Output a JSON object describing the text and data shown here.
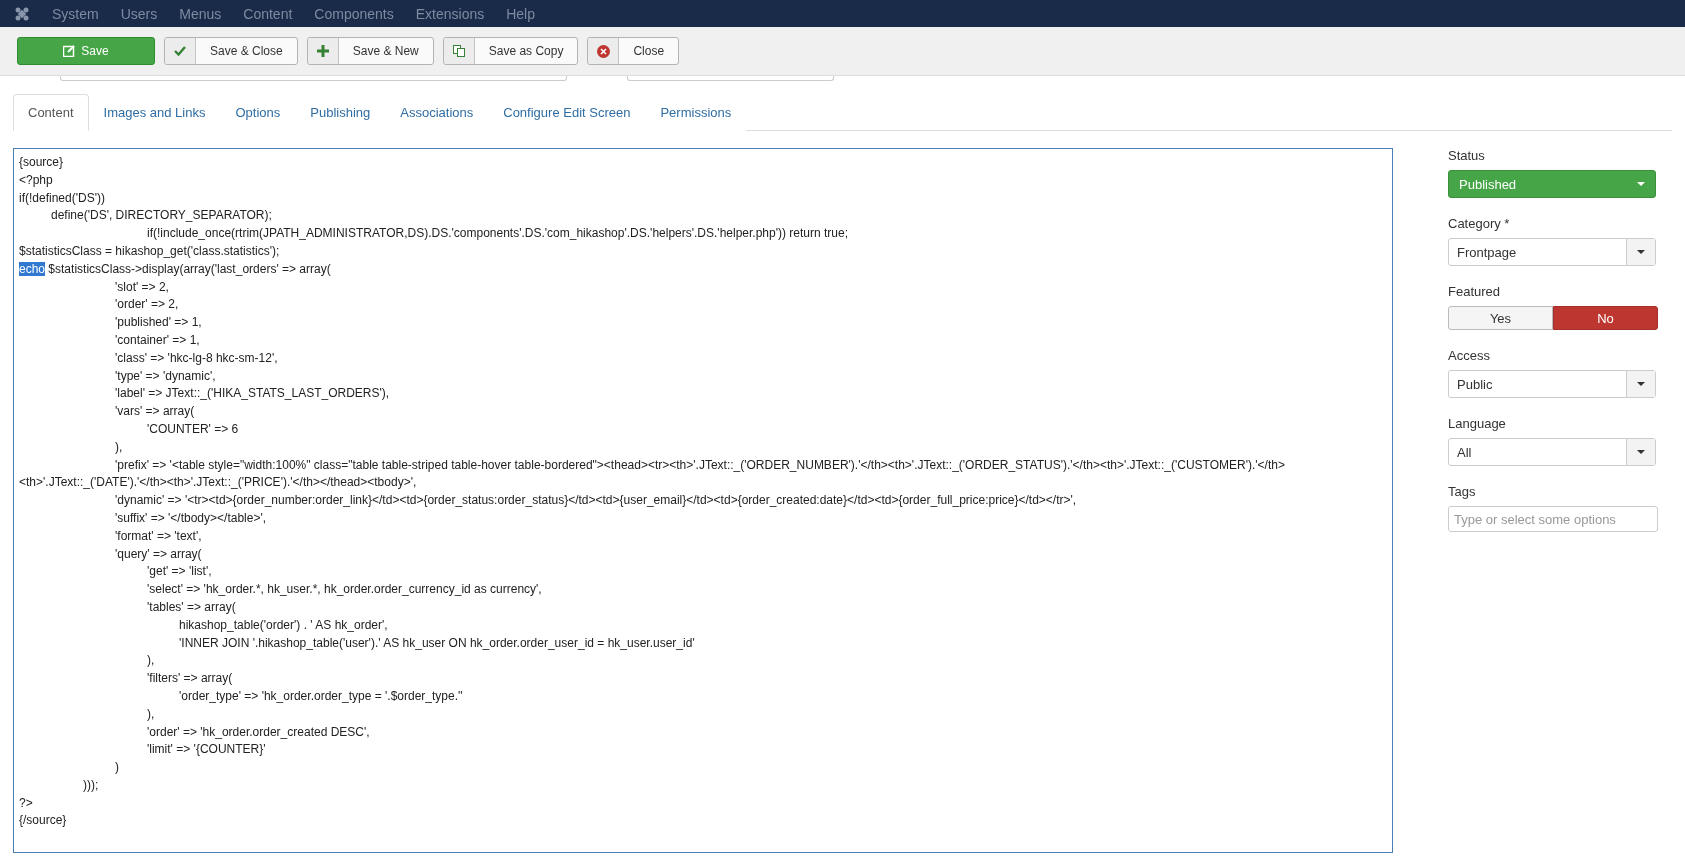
{
  "menu": [
    "System",
    "Users",
    "Menus",
    "Content",
    "Components",
    "Extensions",
    "Help"
  ],
  "toolbar": [
    {
      "kind": "primary",
      "label": "Save"
    },
    {
      "kind": "default",
      "label": "Save & Close"
    },
    {
      "kind": "default",
      "label": "Save & New"
    },
    {
      "kind": "default",
      "label": "Save as Copy"
    },
    {
      "kind": "default",
      "label": "Close"
    }
  ],
  "tabs": [
    {
      "label": "Content",
      "selected": true
    },
    {
      "label": "Images and Links",
      "selected": false
    },
    {
      "label": "Options",
      "selected": false
    },
    {
      "label": "Publishing",
      "selected": false
    },
    {
      "label": "Associations",
      "selected": false
    },
    {
      "label": "Configure Edit Screen",
      "selected": false
    },
    {
      "label": "Permissions",
      "selected": false
    }
  ],
  "editor": {
    "lines": [
      {
        "text": "{source}"
      },
      {
        "text": "<?php"
      },
      {
        "text": "if(!defined('DS'))"
      },
      {
        "text": "\tdefine('DS', DIRECTORY_SEPARATOR);"
      },
      {
        "text": "\t\t\t\tif(!include_once(rtrim(JPATH_ADMINISTRATOR,DS).DS.'components'.DS.'com_hikashop'.DS.'helpers'.DS.'helper.php')) return true;"
      },
      {
        "text": "$statisticsClass = hikashop_get('class.statistics');"
      },
      {
        "selected_text": "echo",
        "text": " $statisticsClass->display(array('last_orders' => array("
      },
      {
        "text": "\t\t\t'slot' => 2,"
      },
      {
        "text": "\t\t\t'order' => 2,"
      },
      {
        "text": "\t\t\t'published' => 1,"
      },
      {
        "text": "\t\t\t'container' => 1,"
      },
      {
        "text": "\t\t\t'class' => 'hkc-lg-8 hkc-sm-12',"
      },
      {
        "text": "\t\t\t'type' => 'dynamic',"
      },
      {
        "text": "\t\t\t'label' => JText::_('HIKA_STATS_LAST_ORDERS'),"
      },
      {
        "text": "\t\t\t'vars' => array("
      },
      {
        "text": "\t\t\t\t'COUNTER' => 6"
      },
      {
        "text": "\t\t\t),"
      },
      {
        "text": "\t\t\t'prefix' => '<table style=\"width:100%\" class=\"table table-striped table-hover table-bordered\"><thead><tr><th>'.JText::_('ORDER_NUMBER').'</th><th>'.JText::_('ORDER_STATUS').'</th><th>'.JText::_('CUSTOMER').'</th><th>'.JText::_('DATE').'</th><th>'.JText::_('PRICE').'</th></thead><tbody>',"
      },
      {
        "text": "\t\t\t'dynamic' => '<tr><td>{order_number:order_link}</td><td>{order_status:order_status}</td><td>{user_email}</td><td>{order_created:date}</td><td>{order_full_price:price}</td></tr>',"
      },
      {
        "text": "\t\t\t'suffix' => '</tbody></table>',"
      },
      {
        "text": "\t\t\t'format' => 'text',"
      },
      {
        "text": "\t\t\t'query' => array("
      },
      {
        "text": "\t\t\t\t'get' => 'list',"
      },
      {
        "text": "\t\t\t\t'select' => 'hk_order.*, hk_user.*, hk_order.order_currency_id as currency',"
      },
      {
        "text": "\t\t\t\t'tables' => array("
      },
      {
        "text": "\t\t\t\t\thikashop_table('order') . ' AS hk_order',"
      },
      {
        "text": "\t\t\t\t\t'INNER JOIN '.hikashop_table('user').' AS hk_user ON hk_order.order_user_id = hk_user.user_id'"
      },
      {
        "text": "\t\t\t\t),"
      },
      {
        "text": "\t\t\t\t'filters' => array("
      },
      {
        "text": "\t\t\t\t\t'order_type' => 'hk_order.order_type = '.$order_type.''"
      },
      {
        "text": "\t\t\t\t),"
      },
      {
        "text": "\t\t\t\t'order' => 'hk_order.order_created DESC',"
      },
      {
        "text": "\t\t\t\t'limit' => '{COUNTER}'"
      },
      {
        "text": "\t\t\t)"
      },
      {
        "text": "\t\t)));"
      },
      {
        "text": "?>"
      },
      {
        "text": "{/source}"
      }
    ]
  },
  "sidebar": [
    {
      "kind": "status",
      "label": "Status",
      "value": "Published"
    },
    {
      "kind": "select",
      "label": "Category *",
      "value": "Frontpage"
    },
    {
      "kind": "toggle",
      "label": "Featured",
      "options": [
        {
          "label": "Yes",
          "selected": false
        },
        {
          "label": "No",
          "selected": true
        }
      ]
    },
    {
      "kind": "select",
      "label": "Access",
      "value": "Public"
    },
    {
      "kind": "select",
      "label": "Language",
      "value": "All"
    },
    {
      "kind": "tags",
      "label": "Tags",
      "placeholder": "Type or select some options"
    }
  ]
}
